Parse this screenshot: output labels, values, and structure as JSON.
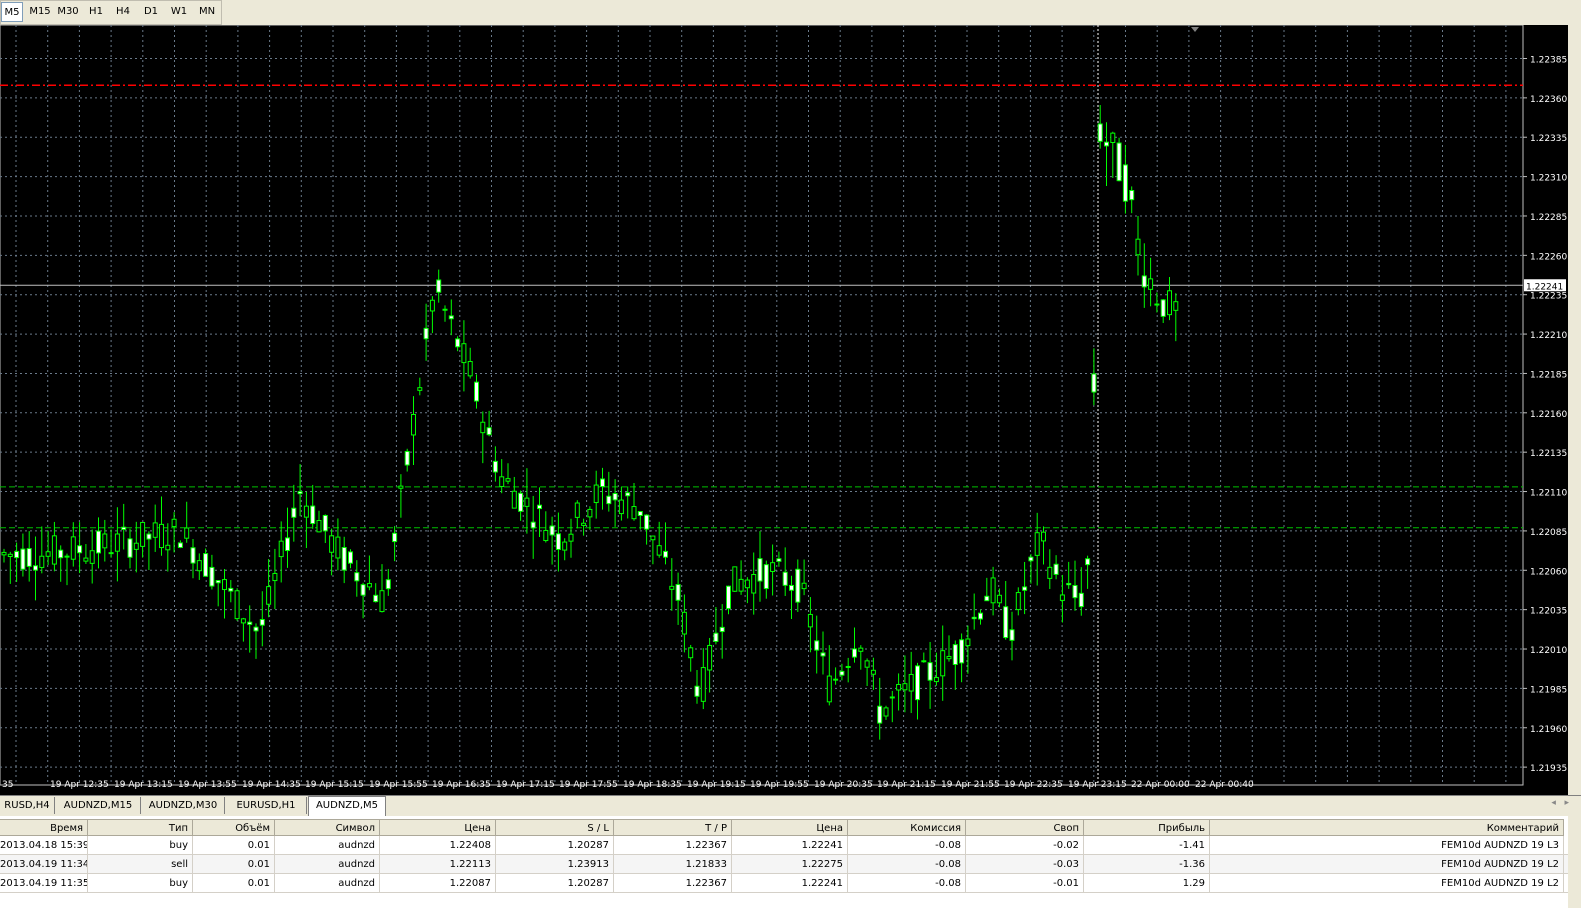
{
  "timeframes": [
    "M5",
    "M15",
    "M30",
    "H1",
    "H4",
    "D1",
    "W1",
    "MN"
  ],
  "active_timeframe": "M5",
  "chart_data": {
    "type": "candlestick",
    "symbol_tab": "AUDNZD,M5",
    "y_ticks": [
      "1.22385",
      "1.22360",
      "1.22335",
      "1.22310",
      "1.22285",
      "1.22260",
      "1.22235",
      "1.22210",
      "1.22185",
      "1.22160",
      "1.22135",
      "1.22110",
      "1.22085",
      "1.22060",
      "1.22035",
      "1.22010",
      "1.21985",
      "1.21960",
      "1.21935"
    ],
    "ylim": [
      1.2193,
      1.22405
    ],
    "current_price": "1.22241",
    "red_line": 1.22368,
    "green_lines": [
      1.22113,
      1.22087
    ],
    "x_labels": [
      "35",
      "19 Apr 12:35",
      "19 Apr 13:15",
      "19 Apr 13:55",
      "19 Apr 14:35",
      "19 Apr 15:15",
      "19 Apr 15:55",
      "19 Apr 16:35",
      "19 Apr 17:15",
      "19 Apr 17:55",
      "19 Apr 18:35",
      "19 Apr 19:15",
      "19 Apr 19:55",
      "19 Apr 20:35",
      "19 Apr 21:15",
      "19 Apr 21:55",
      "19 Apr 22:35",
      "19 Apr 23:15",
      "22 Apr 00:00",
      "22 Apr 00:40"
    ],
    "grid": true,
    "colors": {
      "background": "#000000",
      "candle": "#00ff00",
      "grid": "#6a7a8a",
      "red_line": "#ff0000",
      "green_line": "#00c000"
    }
  },
  "chart_tabs": [
    "RUSD,H4",
    "AUDNZD,M15",
    "AUDNZD,M30",
    "EURUSD,H1",
    "AUDNZD,M5"
  ],
  "active_chart_tab": "AUDNZD,M5",
  "trades": {
    "headers": [
      "Время",
      "Тип",
      "Объём",
      "Символ",
      "Цена",
      "S / L",
      "T / P",
      "Цена",
      "Комиссия",
      "Своп",
      "Прибыль",
      "Комментарий"
    ],
    "rows": [
      [
        "2013.04.18 15:39",
        "buy",
        "0.01",
        "audnzd",
        "1.22408",
        "1.20287",
        "1.22367",
        "1.22241",
        "-0.08",
        "-0.02",
        "-1.41",
        "FEM10d AUDNZD 19 L3"
      ],
      [
        "2013.04.19 11:34",
        "sell",
        "0.01",
        "audnzd",
        "1.22113",
        "1.23913",
        "1.21833",
        "1.22275",
        "-0.08",
        "-0.03",
        "-1.36",
        "FEM10d AUDNZD 19 L2"
      ],
      [
        "2013.04.19 11:35",
        "buy",
        "0.01",
        "audnzd",
        "1.22087",
        "1.20287",
        "1.22367",
        "1.22241",
        "-0.08",
        "-0.01",
        "1.29",
        "FEM10d AUDNZD 19 L2"
      ]
    ]
  }
}
